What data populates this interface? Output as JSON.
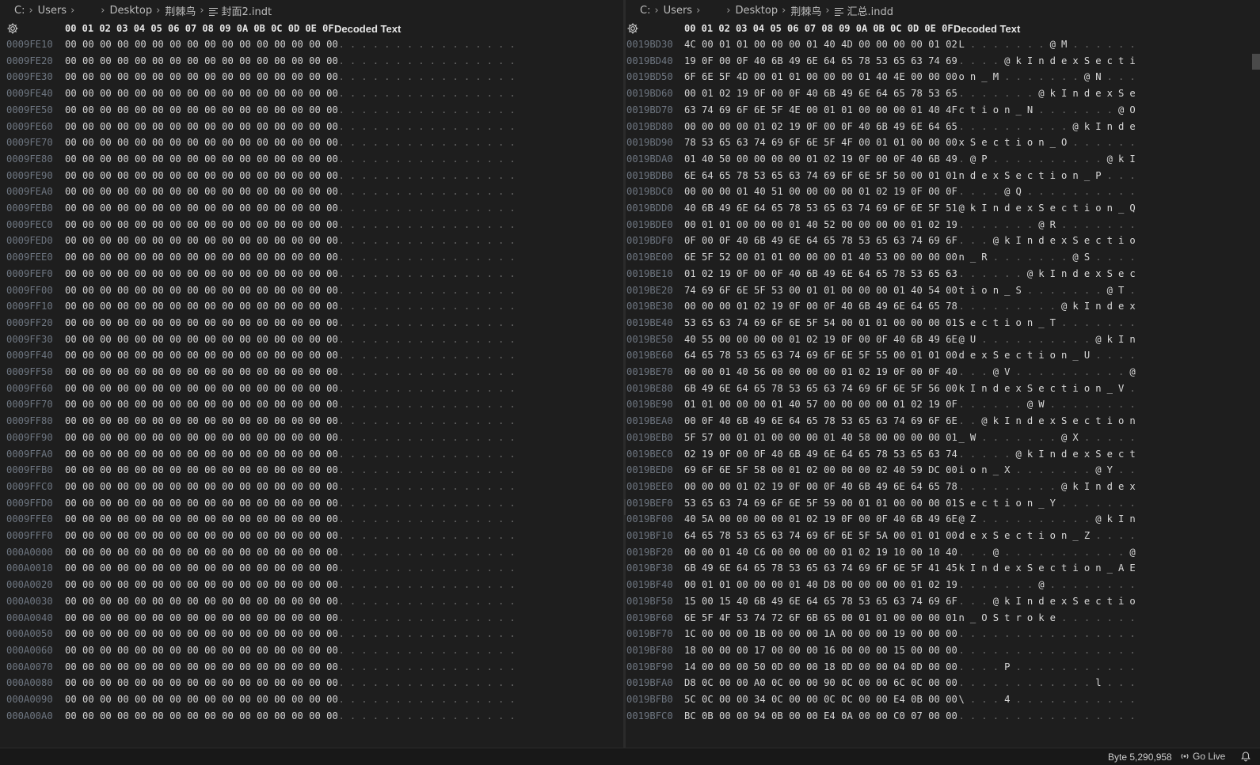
{
  "left_pane": {
    "breadcrumb": {
      "drive": "C:",
      "users": "Users",
      "desktop": "Desktop",
      "folder": "荆棘鸟",
      "file": "封面2.indt"
    },
    "header": {
      "columns": "00 01 02 03 04 05 06 07 08 09 0A 0B 0C 0D 0E 0F",
      "decoded": "Decoded Text"
    },
    "rows": [
      {
        "addr": "0009FE10",
        "hex": "00 00 00 00 00 00 00 00 00 00 00 00 00 00 00 00",
        "dec": "................"
      },
      {
        "addr": "0009FE20",
        "hex": "00 00 00 00 00 00 00 00 00 00 00 00 00 00 00 00",
        "dec": "................"
      },
      {
        "addr": "0009FE30",
        "hex": "00 00 00 00 00 00 00 00 00 00 00 00 00 00 00 00",
        "dec": "................"
      },
      {
        "addr": "0009FE40",
        "hex": "00 00 00 00 00 00 00 00 00 00 00 00 00 00 00 00",
        "dec": "................"
      },
      {
        "addr": "0009FE50",
        "hex": "00 00 00 00 00 00 00 00 00 00 00 00 00 00 00 00",
        "dec": "................"
      },
      {
        "addr": "0009FE60",
        "hex": "00 00 00 00 00 00 00 00 00 00 00 00 00 00 00 00",
        "dec": "................"
      },
      {
        "addr": "0009FE70",
        "hex": "00 00 00 00 00 00 00 00 00 00 00 00 00 00 00 00",
        "dec": "................"
      },
      {
        "addr": "0009FE80",
        "hex": "00 00 00 00 00 00 00 00 00 00 00 00 00 00 00 00",
        "dec": "................"
      },
      {
        "addr": "0009FE90",
        "hex": "00 00 00 00 00 00 00 00 00 00 00 00 00 00 00 00",
        "dec": "................"
      },
      {
        "addr": "0009FEA0",
        "hex": "00 00 00 00 00 00 00 00 00 00 00 00 00 00 00 00",
        "dec": "................"
      },
      {
        "addr": "0009FEB0",
        "hex": "00 00 00 00 00 00 00 00 00 00 00 00 00 00 00 00",
        "dec": "................"
      },
      {
        "addr": "0009FEC0",
        "hex": "00 00 00 00 00 00 00 00 00 00 00 00 00 00 00 00",
        "dec": "................"
      },
      {
        "addr": "0009FED0",
        "hex": "00 00 00 00 00 00 00 00 00 00 00 00 00 00 00 00",
        "dec": "................"
      },
      {
        "addr": "0009FEE0",
        "hex": "00 00 00 00 00 00 00 00 00 00 00 00 00 00 00 00",
        "dec": "................"
      },
      {
        "addr": "0009FEF0",
        "hex": "00 00 00 00 00 00 00 00 00 00 00 00 00 00 00 00",
        "dec": "................"
      },
      {
        "addr": "0009FF00",
        "hex": "00 00 00 00 00 00 00 00 00 00 00 00 00 00 00 00",
        "dec": "................"
      },
      {
        "addr": "0009FF10",
        "hex": "00 00 00 00 00 00 00 00 00 00 00 00 00 00 00 00",
        "dec": "................"
      },
      {
        "addr": "0009FF20",
        "hex": "00 00 00 00 00 00 00 00 00 00 00 00 00 00 00 00",
        "dec": "................"
      },
      {
        "addr": "0009FF30",
        "hex": "00 00 00 00 00 00 00 00 00 00 00 00 00 00 00 00",
        "dec": "................"
      },
      {
        "addr": "0009FF40",
        "hex": "00 00 00 00 00 00 00 00 00 00 00 00 00 00 00 00",
        "dec": "................"
      },
      {
        "addr": "0009FF50",
        "hex": "00 00 00 00 00 00 00 00 00 00 00 00 00 00 00 00",
        "dec": "................"
      },
      {
        "addr": "0009FF60",
        "hex": "00 00 00 00 00 00 00 00 00 00 00 00 00 00 00 00",
        "dec": "................"
      },
      {
        "addr": "0009FF70",
        "hex": "00 00 00 00 00 00 00 00 00 00 00 00 00 00 00 00",
        "dec": "................"
      },
      {
        "addr": "0009FF80",
        "hex": "00 00 00 00 00 00 00 00 00 00 00 00 00 00 00 00",
        "dec": "................"
      },
      {
        "addr": "0009FF90",
        "hex": "00 00 00 00 00 00 00 00 00 00 00 00 00 00 00 00",
        "dec": "................"
      },
      {
        "addr": "0009FFA0",
        "hex": "00 00 00 00 00 00 00 00 00 00 00 00 00 00 00 00",
        "dec": "................"
      },
      {
        "addr": "0009FFB0",
        "hex": "00 00 00 00 00 00 00 00 00 00 00 00 00 00 00 00",
        "dec": "................"
      },
      {
        "addr": "0009FFC0",
        "hex": "00 00 00 00 00 00 00 00 00 00 00 00 00 00 00 00",
        "dec": "................"
      },
      {
        "addr": "0009FFD0",
        "hex": "00 00 00 00 00 00 00 00 00 00 00 00 00 00 00 00",
        "dec": "................"
      },
      {
        "addr": "0009FFE0",
        "hex": "00 00 00 00 00 00 00 00 00 00 00 00 00 00 00 00",
        "dec": "................"
      },
      {
        "addr": "0009FFF0",
        "hex": "00 00 00 00 00 00 00 00 00 00 00 00 00 00 00 00",
        "dec": "................"
      },
      {
        "addr": "000A0000",
        "hex": "00 00 00 00 00 00 00 00 00 00 00 00 00 00 00 00",
        "dec": "................"
      },
      {
        "addr": "000A0010",
        "hex": "00 00 00 00 00 00 00 00 00 00 00 00 00 00 00 00",
        "dec": "................"
      },
      {
        "addr": "000A0020",
        "hex": "00 00 00 00 00 00 00 00 00 00 00 00 00 00 00 00",
        "dec": "................"
      },
      {
        "addr": "000A0030",
        "hex": "00 00 00 00 00 00 00 00 00 00 00 00 00 00 00 00",
        "dec": "................"
      },
      {
        "addr": "000A0040",
        "hex": "00 00 00 00 00 00 00 00 00 00 00 00 00 00 00 00",
        "dec": "................"
      },
      {
        "addr": "000A0050",
        "hex": "00 00 00 00 00 00 00 00 00 00 00 00 00 00 00 00",
        "dec": "................"
      },
      {
        "addr": "000A0060",
        "hex": "00 00 00 00 00 00 00 00 00 00 00 00 00 00 00 00",
        "dec": "................"
      },
      {
        "addr": "000A0070",
        "hex": "00 00 00 00 00 00 00 00 00 00 00 00 00 00 00 00",
        "dec": "................"
      },
      {
        "addr": "000A0080",
        "hex": "00 00 00 00 00 00 00 00 00 00 00 00 00 00 00 00",
        "dec": "................"
      },
      {
        "addr": "000A0090",
        "hex": "00 00 00 00 00 00 00 00 00 00 00 00 00 00 00 00",
        "dec": "................"
      },
      {
        "addr": "000A00A0",
        "hex": "00 00 00 00 00 00 00 00 00 00 00 00 00 00 00 00",
        "dec": "................"
      }
    ]
  },
  "right_pane": {
    "breadcrumb": {
      "drive": "C:",
      "users": "Users",
      "desktop": "Desktop",
      "folder": "荆棘鸟",
      "file": "汇总.indd"
    },
    "header": {
      "columns": "00 01 02 03 04 05 06 07 08 09 0A 0B 0C 0D 0E 0F",
      "decoded": "Decoded Text"
    },
    "rows": [
      {
        "addr": "0019BD30",
        "hex": "4C 00 01 01 00 00 00 01 40 4D 00 00 00 00 01 02",
        "dec": "L.......@M......"
      },
      {
        "addr": "0019BD40",
        "hex": "19 0F 00 0F 40 6B 49 6E 64 65 78 53 65 63 74 69",
        "dec": "....@kIndexSecti"
      },
      {
        "addr": "0019BD50",
        "hex": "6F 6E 5F 4D 00 01 01 00 00 00 01 40 4E 00 00 00",
        "dec": "on_M.......@N..."
      },
      {
        "addr": "0019BD60",
        "hex": "00 01 02 19 0F 00 0F 40 6B 49 6E 64 65 78 53 65",
        "dec": ".......@kIndexSe"
      },
      {
        "addr": "0019BD70",
        "hex": "63 74 69 6F 6E 5F 4E 00 01 01 00 00 00 01 40 4F",
        "dec": "ction_N.......@O"
      },
      {
        "addr": "0019BD80",
        "hex": "00 00 00 00 01 02 19 0F 00 0F 40 6B 49 6E 64 65",
        "dec": "..........@kInde"
      },
      {
        "addr": "0019BD90",
        "hex": "78 53 65 63 74 69 6F 6E 5F 4F 00 01 01 00 00 00",
        "dec": "xSection_O......"
      },
      {
        "addr": "0019BDA0",
        "hex": "01 40 50 00 00 00 00 01 02 19 0F 00 0F 40 6B 49",
        "dec": ".@P..........@kI"
      },
      {
        "addr": "0019BDB0",
        "hex": "6E 64 65 78 53 65 63 74 69 6F 6E 5F 50 00 01 01",
        "dec": "ndexSection_P..."
      },
      {
        "addr": "0019BDC0",
        "hex": "00 00 00 01 40 51 00 00 00 00 01 02 19 0F 00 0F",
        "dec": "....@Q.........."
      },
      {
        "addr": "0019BDD0",
        "hex": "40 6B 49 6E 64 65 78 53 65 63 74 69 6F 6E 5F 51",
        "dec": "@kIndexSection_Q"
      },
      {
        "addr": "0019BDE0",
        "hex": "00 01 01 00 00 00 01 40 52 00 00 00 00 01 02 19",
        "dec": ".......@R......."
      },
      {
        "addr": "0019BDF0",
        "hex": "0F 00 0F 40 6B 49 6E 64 65 78 53 65 63 74 69 6F",
        "dec": "...@kIndexSectio"
      },
      {
        "addr": "0019BE00",
        "hex": "6E 5F 52 00 01 01 00 00 00 01 40 53 00 00 00 00",
        "dec": "n_R.......@S...."
      },
      {
        "addr": "0019BE10",
        "hex": "01 02 19 0F 00 0F 40 6B 49 6E 64 65 78 53 65 63",
        "dec": "......@kIndexSec"
      },
      {
        "addr": "0019BE20",
        "hex": "74 69 6F 6E 5F 53 00 01 01 00 00 00 01 40 54 00",
        "dec": "tion_S.......@T."
      },
      {
        "addr": "0019BE30",
        "hex": "00 00 00 01 02 19 0F 00 0F 40 6B 49 6E 64 65 78",
        "dec": ".........@kIndex"
      },
      {
        "addr": "0019BE40",
        "hex": "53 65 63 74 69 6F 6E 5F 54 00 01 01 00 00 00 01",
        "dec": "Section_T......."
      },
      {
        "addr": "0019BE50",
        "hex": "40 55 00 00 00 00 01 02 19 0F 00 0F 40 6B 49 6E",
        "dec": "@U..........@kIn"
      },
      {
        "addr": "0019BE60",
        "hex": "64 65 78 53 65 63 74 69 6F 6E 5F 55 00 01 01 00",
        "dec": "dexSection_U...."
      },
      {
        "addr": "0019BE70",
        "hex": "00 00 01 40 56 00 00 00 00 01 02 19 0F 00 0F 40",
        "dec": "...@V..........@"
      },
      {
        "addr": "0019BE80",
        "hex": "6B 49 6E 64 65 78 53 65 63 74 69 6F 6E 5F 56 00",
        "dec": "kIndexSection_V."
      },
      {
        "addr": "0019BE90",
        "hex": "01 01 00 00 00 01 40 57 00 00 00 00 01 02 19 0F",
        "dec": "......@W........"
      },
      {
        "addr": "0019BEA0",
        "hex": "00 0F 40 6B 49 6E 64 65 78 53 65 63 74 69 6F 6E",
        "dec": "..@kIndexSection"
      },
      {
        "addr": "0019BEB0",
        "hex": "5F 57 00 01 01 00 00 00 01 40 58 00 00 00 00 01",
        "dec": "_W.......@X....."
      },
      {
        "addr": "0019BEC0",
        "hex": "02 19 0F 00 0F 40 6B 49 6E 64 65 78 53 65 63 74",
        "dec": ".....@kIndexSect"
      },
      {
        "addr": "0019BED0",
        "hex": "69 6F 6E 5F 58 00 01 02 00 00 00 02 40 59 DC 00",
        "dec": "ion_X.......@Y.."
      },
      {
        "addr": "0019BEE0",
        "hex": "00 00 00 01 02 19 0F 00 0F 40 6B 49 6E 64 65 78",
        "dec": ".........@kIndex"
      },
      {
        "addr": "0019BEF0",
        "hex": "53 65 63 74 69 6F 6E 5F 59 00 01 01 00 00 00 01",
        "dec": "Section_Y......."
      },
      {
        "addr": "0019BF00",
        "hex": "40 5A 00 00 00 00 01 02 19 0F 00 0F 40 6B 49 6E",
        "dec": "@Z..........@kIn"
      },
      {
        "addr": "0019BF10",
        "hex": "64 65 78 53 65 63 74 69 6F 6E 5F 5A 00 01 01 00",
        "dec": "dexSection_Z...."
      },
      {
        "addr": "0019BF20",
        "hex": "00 00 01 40 C6 00 00 00 00 01 02 19 10 00 10 40",
        "dec": "...@...........@"
      },
      {
        "addr": "0019BF30",
        "hex": "6B 49 6E 64 65 78 53 65 63 74 69 6F 6E 5F 41 45",
        "dec": "kIndexSection_AE"
      },
      {
        "addr": "0019BF40",
        "hex": "00 01 01 00 00 00 01 40 D8 00 00 00 00 01 02 19",
        "dec": ".......@........"
      },
      {
        "addr": "0019BF50",
        "hex": "15 00 15 40 6B 49 6E 64 65 78 53 65 63 74 69 6F",
        "dec": "...@kIndexSectio"
      },
      {
        "addr": "0019BF60",
        "hex": "6E 5F 4F 53 74 72 6F 6B 65 00 01 01 00 00 00 01",
        "dec": "n_OStroke......."
      },
      {
        "addr": "0019BF70",
        "hex": "1C 00 00 00 1B 00 00 00 1A 00 00 00 19 00 00 00",
        "dec": "................"
      },
      {
        "addr": "0019BF80",
        "hex": "18 00 00 00 17 00 00 00 16 00 00 00 15 00 00 00",
        "dec": "................"
      },
      {
        "addr": "0019BF90",
        "hex": "14 00 00 00 50 0D 00 00 18 0D 00 00 04 0D 00 00",
        "dec": "....P..........."
      },
      {
        "addr": "0019BFA0",
        "hex": "D8 0C 00 00 A0 0C 00 00 90 0C 00 00 6C 0C 00 00",
        "dec": "............l..."
      },
      {
        "addr": "0019BFB0",
        "hex": "5C 0C 00 00 34 0C 00 00 0C 0C 00 00 E4 0B 00 00",
        "dec": "\\...4..........."
      },
      {
        "addr": "0019BFC0",
        "hex": "BC 0B 00 00 94 0B 00 00 E4 0A 00 00 C0 07 00 00",
        "dec": "................"
      }
    ]
  },
  "statusbar": {
    "byte_position": "Byte 5,290,958",
    "go_live": "Go Live"
  }
}
